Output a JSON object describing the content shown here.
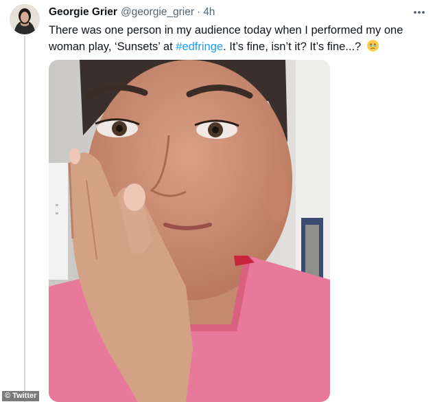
{
  "author": {
    "name": "Georgie Grier",
    "handle": "@georgie_grier",
    "separator": "·",
    "time": "4h"
  },
  "tweet": {
    "text_before": "There was one person in my audience today when I performed my one woman play, ‘Sunsets’ at ",
    "hashtag": "#edfringe",
    "text_after": ". It’s fine, isn’t it? It’s fine...?"
  },
  "icons": {
    "more": "more-options-icon",
    "emoji": "face-holding-back-tears-emoji"
  },
  "credit": "© Twitter",
  "colors": {
    "link": "#1d9bf0",
    "secondary": "#536471",
    "shirt": "#e8799a"
  }
}
